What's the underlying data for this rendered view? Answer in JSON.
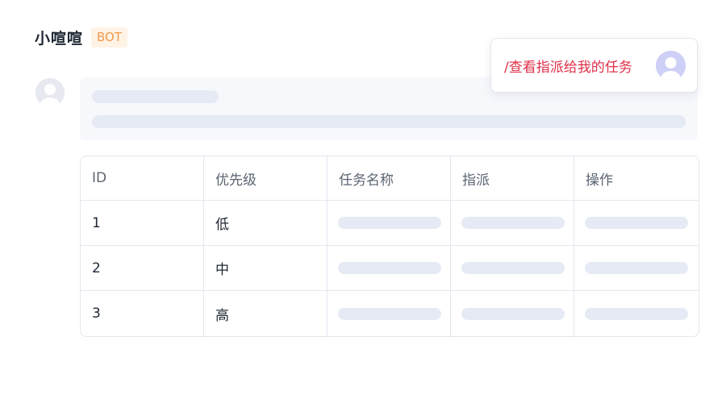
{
  "bot": {
    "name": "小喧喧",
    "badge": "BOT"
  },
  "command": {
    "text": "/查看指派给我的任务"
  },
  "colors": {
    "accent": "#e0304a",
    "badge": "#f39a4a",
    "skeleton": "#e6eaf4"
  },
  "table": {
    "headers": [
      "ID",
      "优先级",
      "任务名称",
      "指派",
      "操作"
    ],
    "rows": [
      {
        "id": "1",
        "priority": "低"
      },
      {
        "id": "2",
        "priority": "中"
      },
      {
        "id": "3",
        "priority": "高"
      }
    ]
  }
}
